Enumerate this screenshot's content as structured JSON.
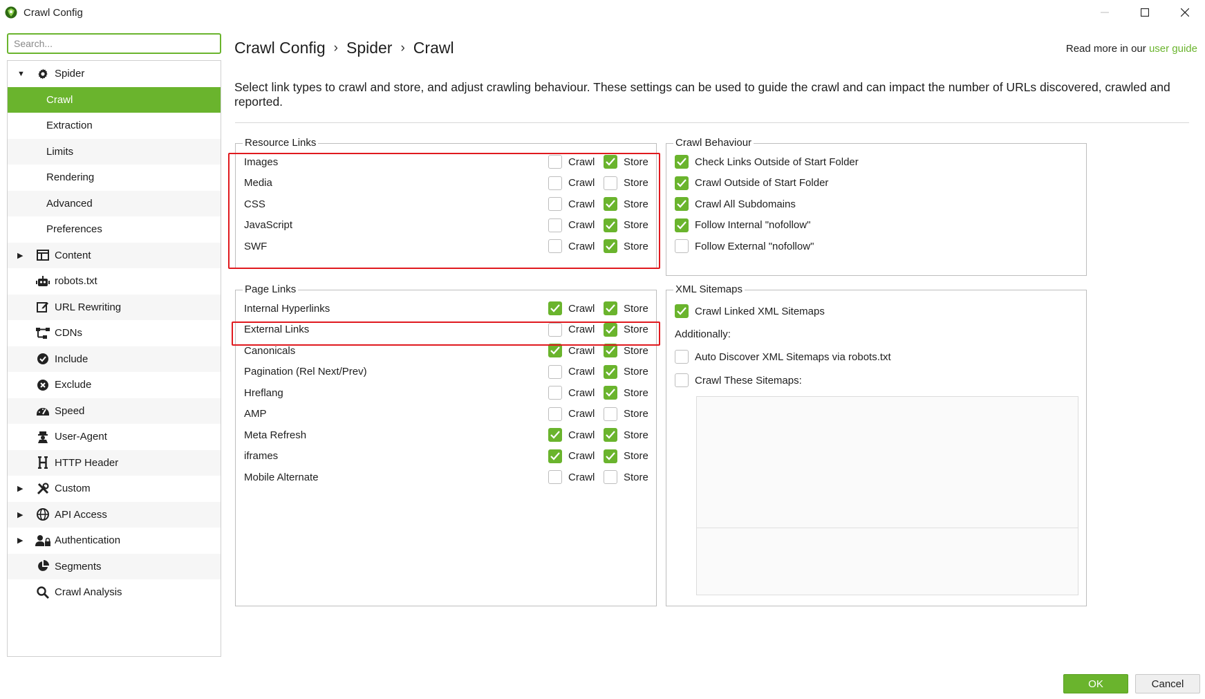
{
  "window": {
    "title": "Crawl Config"
  },
  "search": {
    "placeholder": "Search..."
  },
  "sidebar": {
    "items": [
      {
        "label": "Spider",
        "icon": "gear-icon",
        "arrow": "▼"
      },
      {
        "label": "Crawl"
      },
      {
        "label": "Extraction"
      },
      {
        "label": "Limits"
      },
      {
        "label": "Rendering"
      },
      {
        "label": "Advanced"
      },
      {
        "label": "Preferences"
      },
      {
        "label": "Content",
        "icon": "columns-icon",
        "arrow": "▶"
      },
      {
        "label": "robots.txt",
        "icon": "robot-icon"
      },
      {
        "label": "URL Rewriting",
        "icon": "edit-icon"
      },
      {
        "label": "CDNs",
        "icon": "network-icon"
      },
      {
        "label": "Include",
        "icon": "check-circle-icon"
      },
      {
        "label": "Exclude",
        "icon": "x-circle-icon"
      },
      {
        "label": "Speed",
        "icon": "speedometer-icon"
      },
      {
        "label": "User-Agent",
        "icon": "user-agent-icon"
      },
      {
        "label": "HTTP Header",
        "icon": "header-h-icon"
      },
      {
        "label": "Custom",
        "icon": "tools-icon",
        "arrow": "▶"
      },
      {
        "label": "API Access",
        "icon": "globe-icon",
        "arrow": "▶"
      },
      {
        "label": "Authentication",
        "icon": "user-lock-icon",
        "arrow": "▶"
      },
      {
        "label": "Segments",
        "icon": "pie-icon"
      },
      {
        "label": "Crawl Analysis",
        "icon": "search-icon"
      }
    ]
  },
  "breadcrumb": {
    "items": [
      "Crawl Config",
      "Spider",
      "Crawl"
    ],
    "separator": "›"
  },
  "readmore": {
    "text": "Read more in our",
    "link": "user guide"
  },
  "description": "Select link types to crawl and store, and adjust crawling behaviour. These settings can be used to guide the crawl and can impact the number of URLs discovered, crawled and reported.",
  "resource_links": {
    "title": "Resource Links",
    "crawl_label": "Crawl",
    "store_label": "Store",
    "rows": [
      {
        "label": "Images",
        "crawl": false,
        "store": true
      },
      {
        "label": "Media",
        "crawl": false,
        "store": false
      },
      {
        "label": "CSS",
        "crawl": false,
        "store": true
      },
      {
        "label": "JavaScript",
        "crawl": false,
        "store": true
      },
      {
        "label": "SWF",
        "crawl": false,
        "store": true
      }
    ]
  },
  "page_links": {
    "title": "Page Links",
    "crawl_label": "Crawl",
    "store_label": "Store",
    "rows": [
      {
        "label": "Internal Hyperlinks",
        "crawl": true,
        "store": true
      },
      {
        "label": "External Links",
        "crawl": false,
        "store": true
      },
      {
        "label": "Canonicals",
        "crawl": true,
        "store": true
      },
      {
        "label": "Pagination (Rel Next/Prev)",
        "crawl": false,
        "store": true
      },
      {
        "label": "Hreflang",
        "crawl": false,
        "store": true
      },
      {
        "label": "AMP",
        "crawl": false,
        "store": false
      },
      {
        "label": "Meta Refresh",
        "crawl": true,
        "store": true
      },
      {
        "label": "iframes",
        "crawl": true,
        "store": true
      },
      {
        "label": "Mobile Alternate",
        "crawl": false,
        "store": false
      }
    ]
  },
  "crawl_behaviour": {
    "title": "Crawl Behaviour",
    "items": [
      {
        "label": "Check Links Outside of Start Folder",
        "checked": true
      },
      {
        "label": "Crawl Outside of Start Folder",
        "checked": true
      },
      {
        "label": "Crawl All Subdomains",
        "checked": true
      },
      {
        "label": "Follow Internal \"nofollow\"",
        "checked": true
      },
      {
        "label": "Follow External \"nofollow\"",
        "checked": false
      }
    ]
  },
  "xml_sitemaps": {
    "title": "XML Sitemaps",
    "crawl_linked": {
      "label": "Crawl Linked XML Sitemaps",
      "checked": true
    },
    "additionally": "Additionally:",
    "auto_discover": {
      "label": "Auto Discover XML Sitemaps via robots.txt",
      "checked": false
    },
    "crawl_these": {
      "label": "Crawl These Sitemaps:",
      "checked": false
    }
  },
  "buttons": {
    "ok": "OK",
    "cancel": "Cancel"
  },
  "colors": {
    "accent": "#6ab42d",
    "highlight": "#e0191e"
  }
}
